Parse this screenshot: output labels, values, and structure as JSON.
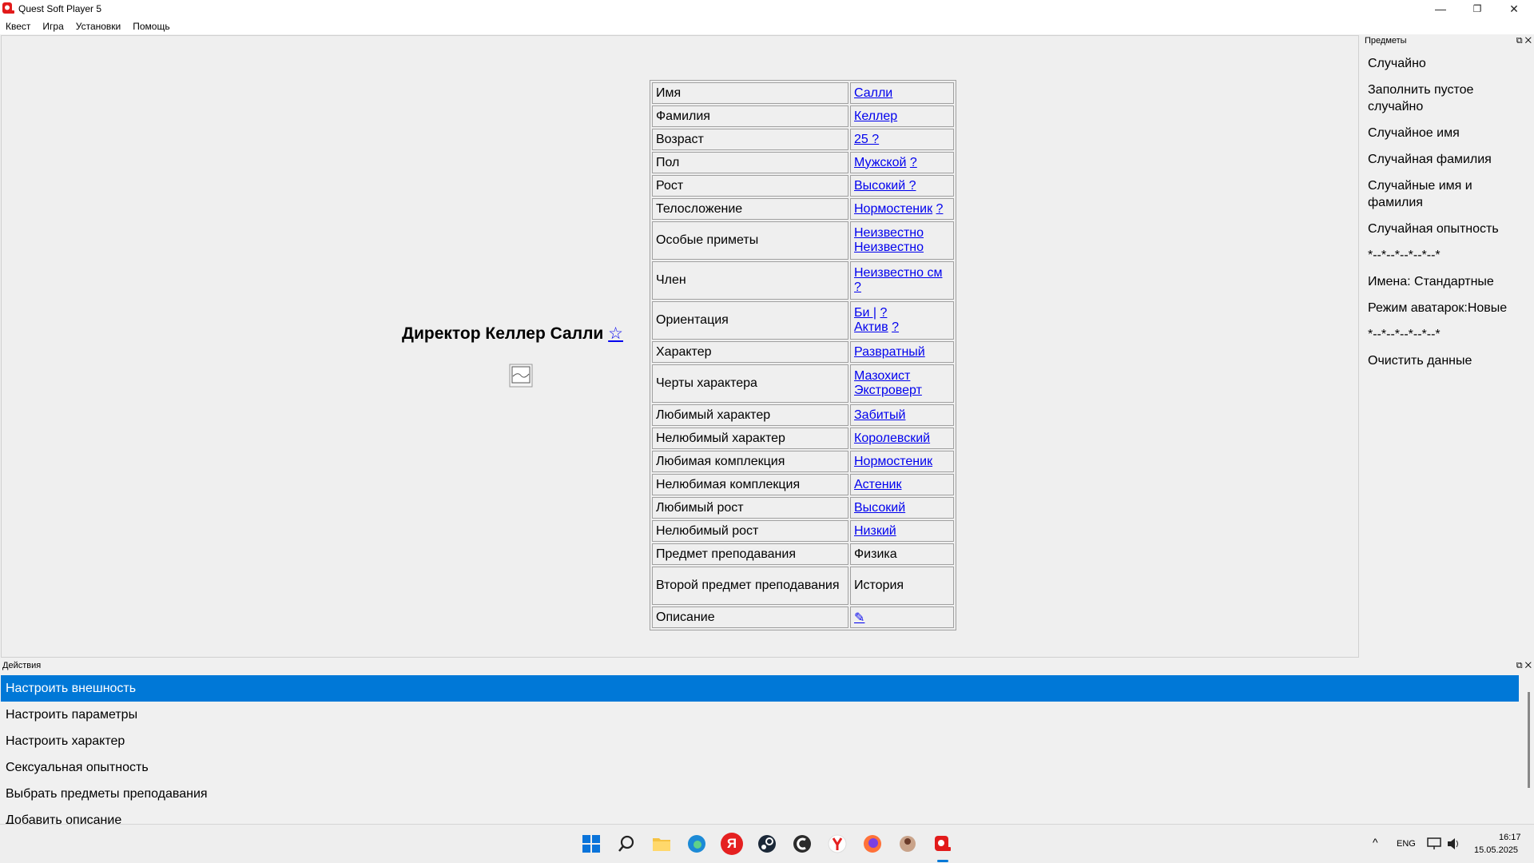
{
  "window": {
    "title": "Quest Soft Player 5",
    "controls": {
      "minimize": "—",
      "restore": "❐",
      "close": "✕"
    }
  },
  "menu": [
    "Квест",
    "Игра",
    "Установки",
    "Помощь"
  ],
  "character": {
    "heading": "Директор Келлер Салли",
    "star": "☆",
    "attributes": [
      {
        "key": "Имя",
        "value": "Салли"
      },
      {
        "key": "Фамилия",
        "value": "Келлер"
      },
      {
        "key": "Возраст",
        "value": "25 ?"
      },
      {
        "key": "Пол",
        "value": "Мужской",
        "hint": "?"
      },
      {
        "key": "Рост",
        "value": "Высокий ?"
      },
      {
        "key": "Телосложение",
        "value": "Нормостеник",
        "hint": "?"
      },
      {
        "key": "Особые приметы",
        "value": "Неизвестно",
        "value2": "Неизвестно"
      },
      {
        "key": "Член",
        "value": "Неизвестно см",
        "hint": "?"
      },
      {
        "key": "Ориентация",
        "value": "Би |",
        "hint": "?",
        "value2": "Актив",
        "hint2": "?"
      },
      {
        "key": "Характер",
        "value": "Развратный"
      },
      {
        "key": "Черты характера",
        "value": "Мазохист",
        "value2": "Экстроверт"
      },
      {
        "key": "Любимый характер",
        "value": "Забитый"
      },
      {
        "key": "Нелюбимый характер",
        "value": "Королевский"
      },
      {
        "key": "Любимая комплекция",
        "value": "Нормостеник"
      },
      {
        "key": "Нелюбимая комплекция",
        "value": "Астеник"
      },
      {
        "key": "Любимый рост",
        "value": "Высокий"
      },
      {
        "key": "Нелюбимый рост",
        "value": "Низкий"
      },
      {
        "key": "Предмет преподавания",
        "value": "Физика"
      },
      {
        "key": "Второй предмет преподавания",
        "value": "История"
      },
      {
        "key": "Описание",
        "value": "✎"
      }
    ]
  },
  "objects_panel": {
    "title": "Предметы",
    "items": [
      "Случайно",
      "Заполнить пустое случайно",
      "Случайное имя",
      "Случайная фамилия",
      "Случайные имя и фамилия",
      "Случайная опытность",
      "*--*--*--*--*--*",
      "Имена: Стандартные",
      "Режим аватарок:Новые",
      "*--*--*--*--*--*",
      "Очистить данные"
    ]
  },
  "actions_panel": {
    "title": "Действия",
    "items": [
      "Настроить внешность",
      "Настроить параметры",
      "Настроить характер",
      "Сексуальная опытность",
      "Выбрать предметы преподавания",
      "Добавить описание"
    ],
    "selected_index": 0
  },
  "taskbar": {
    "yandex_label": "Я",
    "language": "ENG",
    "time": "16:17",
    "date": "15.05.2025"
  },
  "colors": {
    "accent": "#0078d7",
    "link": "#0000ee"
  }
}
